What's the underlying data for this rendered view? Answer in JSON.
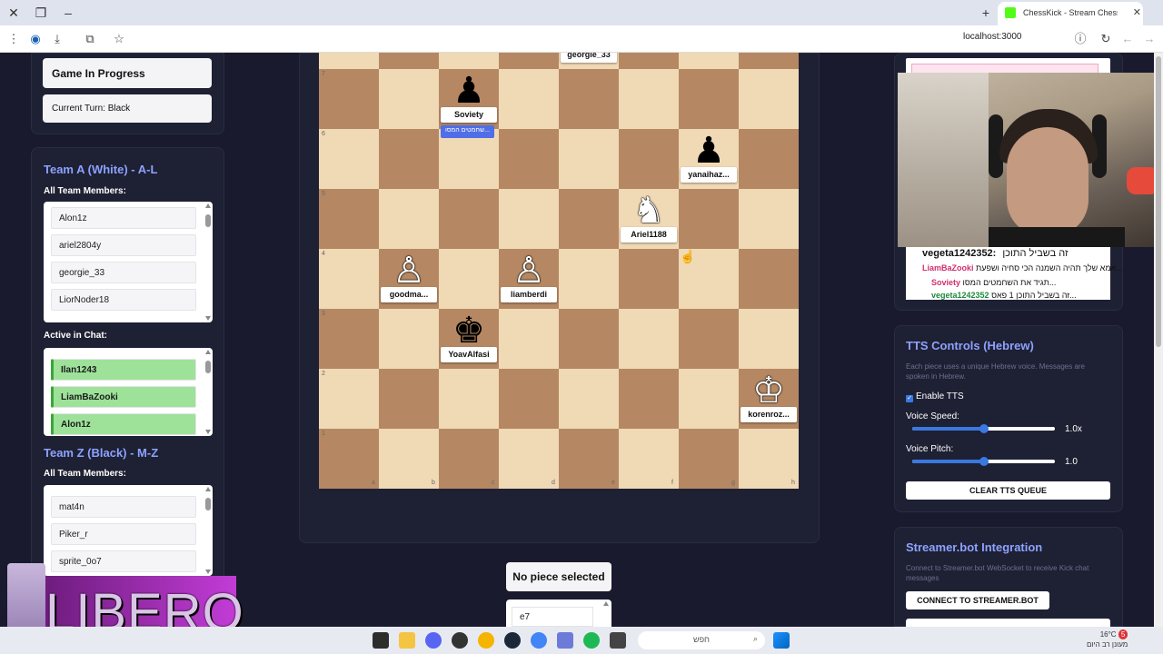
{
  "browser": {
    "tab_title": "ChessKick - Stream Chess G",
    "url": "localhost:3000"
  },
  "game": {
    "status": "Game In Progress",
    "turn": "Current Turn: Black"
  },
  "team_a": {
    "title": "Team A (White) - A-L",
    "members_label": "All Team Members:",
    "members": [
      "Alon1z",
      "ariel2804y",
      "georgie_33",
      "LiorNoder18"
    ],
    "chat_label": "Active in Chat:",
    "active": [
      "Ilan1243",
      "LiamBaZooki",
      "Alon1z"
    ]
  },
  "team_z": {
    "title": "Team Z (Black) - M-Z",
    "members_label": "All Team Members:",
    "members": [
      "mat4n",
      "Piker_r",
      "sprite_0o7"
    ]
  },
  "board": {
    "ranks": [
      "7",
      "6",
      "5",
      "4",
      "3",
      "2",
      "1"
    ],
    "files": [
      "a",
      "b",
      "c",
      "d",
      "e",
      "f",
      "g",
      "h"
    ],
    "pieces": [
      {
        "glyph": "♛",
        "color": "w",
        "label": "georgie_33"
      },
      {
        "glyph": "♟",
        "color": "b",
        "label": "Soviety",
        "bubble": "שחמטים המסו..."
      },
      {
        "glyph": "♟",
        "color": "b",
        "label": "yanaihaz..."
      },
      {
        "glyph": "♞",
        "color": "w",
        "label": "Ariel1188"
      },
      {
        "glyph": "♙",
        "color": "w",
        "label": "goodma..."
      },
      {
        "glyph": "♙",
        "color": "w",
        "label": "liamberdi"
      },
      {
        "glyph": "♚",
        "color": "b",
        "label": "YoavAlfasi"
      },
      {
        "glyph": "♔",
        "color": "w",
        "label": "korenroz..."
      }
    ]
  },
  "selection": {
    "status": "No piece selected",
    "moves": [
      "e7"
    ]
  },
  "chat": {
    "lines": [
      {
        "user": "vegeta1242352:",
        "text": "זה בשביל התוכן"
      },
      {
        "user": "LiamBaZooki",
        "text": "אמא שלך תהיה השמנה הכי סחיה ושפעת..."
      },
      {
        "user": "Soviety",
        "text": "תגיד את השחמטים המסו..."
      },
      {
        "user": "vegeta1242352",
        "text": "זה בשביל התוכן 1 פאס..."
      }
    ]
  },
  "tts": {
    "title": "TTS Controls (Hebrew)",
    "desc": "Each piece uses a unique Hebrew voice. Messages are spoken in Hebrew.",
    "enable_label": "Enable TTS",
    "enabled": true,
    "speed_label": "Voice Speed:",
    "speed_value": "1.0x",
    "speed_level": 1.0,
    "pitch_label": "Voice Pitch:",
    "pitch_value": "1.0",
    "pitch_level": 1.0,
    "clear_button": "CLEAR TTS QUEUE"
  },
  "streamerbot": {
    "title": "Streamer.bot Integration",
    "desc": "Connect to Streamer.bot WebSocket to receive Kick chat messages",
    "connect_button": "CONNECT TO STREAMER.BOT"
  },
  "overlay": {
    "brand": "LIBERO"
  },
  "taskbar": {
    "search": "חפש",
    "temp": "16°C",
    "weather": "מעונן רב היום",
    "notif": "5"
  },
  "colors": {
    "accent": "#8da2ff",
    "board_light": "#f0d9b5",
    "board_dark": "#b58863",
    "active_green": "#9ee29a"
  }
}
